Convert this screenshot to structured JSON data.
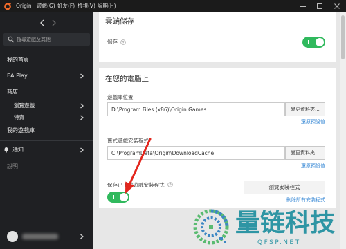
{
  "window": {
    "logo_icon": "origin-logo-icon",
    "menu": [
      "Origin",
      "遊戲(G)",
      "好友(F)",
      "檢視(V)",
      "說明(H)"
    ],
    "controls": [
      "minimize-icon",
      "maximize-icon",
      "close-icon"
    ]
  },
  "sidebar": {
    "nav": {
      "back_icon": "chevron-left-icon",
      "forward_icon": "chevron-right-icon"
    },
    "search": {
      "placeholder": "搜尋遊戲及其他",
      "icon": "search-icon"
    },
    "items": [
      {
        "label": "我的首頁"
      },
      {
        "label": "EA Play",
        "icon": "chevron-right-icon"
      },
      {
        "label": "商店"
      },
      {
        "label": "瀏覽遊戲",
        "icon": "chevron-right-icon"
      },
      {
        "label": "特賣",
        "icon": "chevron-right-icon"
      },
      {
        "label": "我的遊戲庫"
      }
    ],
    "notifications": {
      "label": "通知",
      "icon": "bell-icon"
    },
    "help": {
      "label": "說明"
    },
    "profile": {
      "avatar_icon": "avatar-icon",
      "expand_icon": "chevron-right-icon"
    }
  },
  "settings": {
    "cloud_storage": {
      "heading": "雲端儲存",
      "storage_label": "儲存",
      "help_icon": "question-circle-icon",
      "storage_enabled": true
    },
    "on_computer": {
      "heading": "在您的電腦上",
      "library_location": {
        "label": "遊戲庫位置",
        "value": "D:\\Program Files (x86)\\Origin Games",
        "change_button": "變更資料夾...",
        "restore_link": "還原預設值"
      },
      "legacy_installer": {
        "label": "舊式遊戲安裝程式",
        "value": "C:\\ProgramData\\Origin\\DownloadCache",
        "change_button": "變更資料夾...",
        "restore_link": "還原預設值"
      },
      "keep_installers": {
        "label": "保存已下載遊戲安裝程式",
        "help_icon": "question-circle-icon",
        "enabled": true,
        "browse_button": "瀏覽安裝程式",
        "delete_link": "刪除所有安裝程式"
      }
    }
  },
  "annotation": {
    "icon": "red-arrow-icon"
  },
  "watermark": {
    "logo_icon": "qfsp-logo-icon",
    "brand": "量链科技",
    "site": "QFSP.NET"
  },
  "colors": {
    "origin_orange": "#f26b2a",
    "toggle_green": "#30b95d",
    "link_blue": "#3a8ad6",
    "annotation_red": "#e3261d",
    "watermark_teal": "#1f8f9f",
    "sidebar_bg": "#1f2023"
  }
}
